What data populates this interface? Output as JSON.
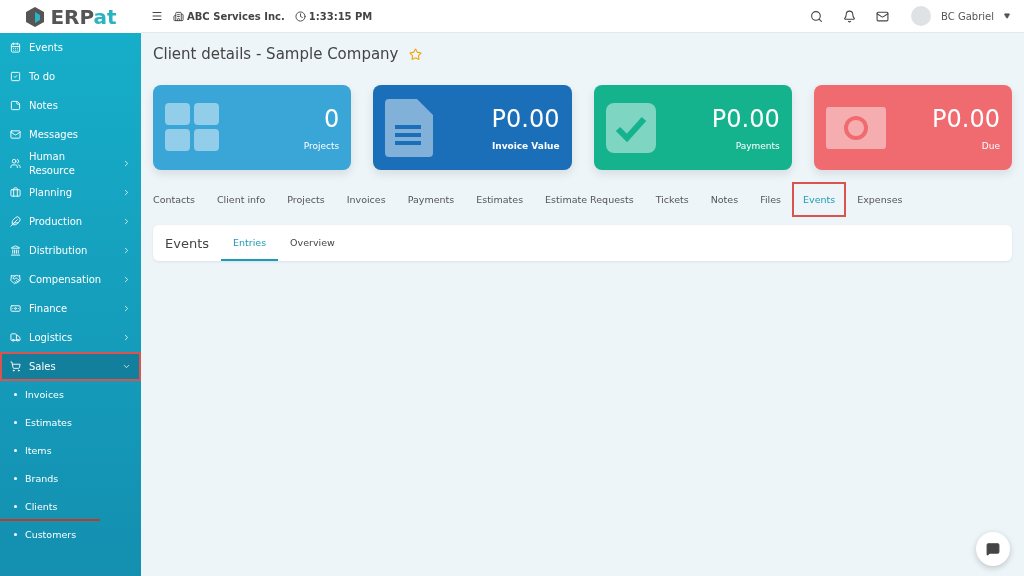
{
  "header": {
    "logo": {
      "prefix": "ERP",
      "suffix": "at"
    },
    "company": "ABC Services Inc.",
    "time": "1:33:15 PM",
    "user": "BC Gabriel"
  },
  "sidebar": {
    "items": [
      {
        "label": "Events",
        "has_submenu": false,
        "selected": false,
        "annotated": false
      },
      {
        "label": "To do",
        "has_submenu": false,
        "selected": false,
        "annotated": false
      },
      {
        "label": "Notes",
        "has_submenu": false,
        "selected": false,
        "annotated": false
      },
      {
        "label": "Messages",
        "has_submenu": false,
        "selected": false,
        "annotated": false
      },
      {
        "label": "Human Resource",
        "has_submenu": true,
        "selected": false,
        "annotated": false
      },
      {
        "label": "Planning",
        "has_submenu": true,
        "selected": false,
        "annotated": false
      },
      {
        "label": "Production",
        "has_submenu": true,
        "selected": false,
        "annotated": false
      },
      {
        "label": "Distribution",
        "has_submenu": true,
        "selected": false,
        "annotated": false
      },
      {
        "label": "Compensation",
        "has_submenu": true,
        "selected": false,
        "annotated": false
      },
      {
        "label": "Finance",
        "has_submenu": true,
        "selected": false,
        "annotated": false
      },
      {
        "label": "Logistics",
        "has_submenu": true,
        "selected": false,
        "annotated": false
      },
      {
        "label": "Sales",
        "has_submenu": true,
        "selected": true,
        "annotated": true,
        "expanded": true,
        "children": [
          {
            "label": "Invoices",
            "underlined": false
          },
          {
            "label": "Estimates",
            "underlined": false
          },
          {
            "label": "Items",
            "underlined": false
          },
          {
            "label": "Brands",
            "underlined": false
          },
          {
            "label": "Clients",
            "underlined": true
          },
          {
            "label": "Customers",
            "underlined": false
          }
        ]
      }
    ]
  },
  "page_title": "Client details - Sample Company",
  "favorite": false,
  "stats": [
    {
      "value": "0",
      "label": "Projects",
      "color": "#3aa6d8",
      "bold_label": false
    },
    {
      "value": "P0.00",
      "label": "Invoice Value",
      "color": "#1a6fb8",
      "bold_label": true
    },
    {
      "value": "P0.00",
      "label": "Payments",
      "color": "#14b38e",
      "bold_label": false
    },
    {
      "value": "P0.00",
      "label": "Due",
      "color": "#ef6b70",
      "bold_label": false
    }
  ],
  "tabs": [
    {
      "label": "Contacts",
      "selected": false,
      "annotated": false
    },
    {
      "label": "Client info",
      "selected": false,
      "annotated": false
    },
    {
      "label": "Projects",
      "selected": false,
      "annotated": false
    },
    {
      "label": "Invoices",
      "selected": false,
      "annotated": false
    },
    {
      "label": "Payments",
      "selected": false,
      "annotated": false
    },
    {
      "label": "Estimates",
      "selected": false,
      "annotated": false
    },
    {
      "label": "Estimate Requests",
      "selected": false,
      "annotated": false
    },
    {
      "label": "Tickets",
      "selected": false,
      "annotated": false
    },
    {
      "label": "Notes",
      "selected": false,
      "annotated": false
    },
    {
      "label": "Files",
      "selected": false,
      "annotated": false
    },
    {
      "label": "Events",
      "selected": true,
      "annotated": true
    },
    {
      "label": "Expenses",
      "selected": false,
      "annotated": false
    }
  ],
  "panel": {
    "title": "Events",
    "tabs": [
      {
        "label": "Entries",
        "selected": true
      },
      {
        "label": "Overview",
        "selected": false
      }
    ]
  }
}
